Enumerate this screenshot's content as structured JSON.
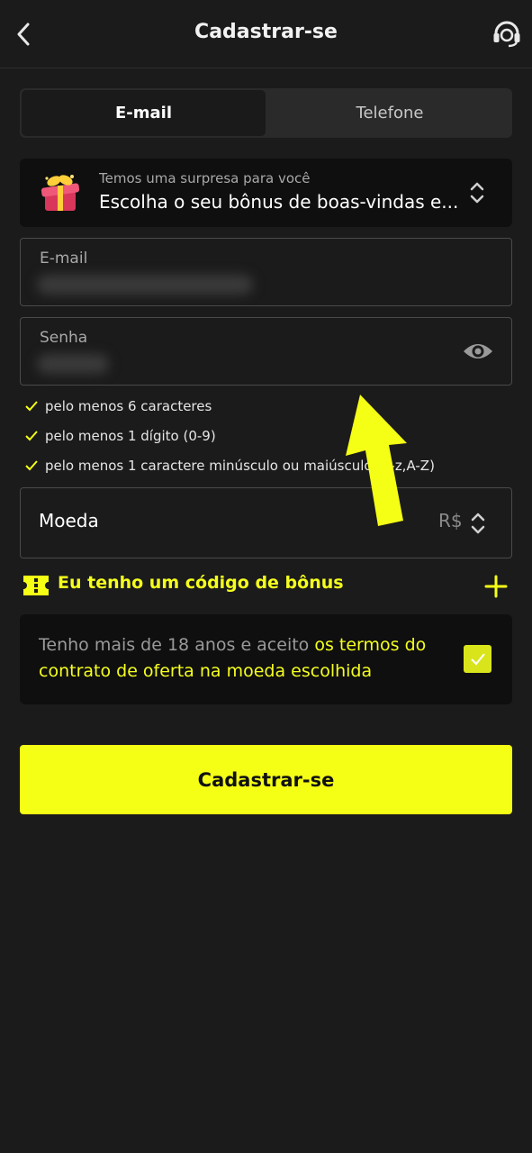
{
  "header": {
    "title": "Cadastrar-se",
    "back_icon": "chevron-left-icon",
    "support_icon": "headset-icon"
  },
  "tabs": [
    {
      "label": "E-mail",
      "active": true
    },
    {
      "label": "Telefone",
      "active": false
    }
  ],
  "bonus_select": {
    "subtitle": "Temos uma surpresa para você",
    "value": "Escolha o seu bônus de boas-vindas e...",
    "icon": "gift-icon"
  },
  "email_field": {
    "label": "E-mail"
  },
  "password_field": {
    "label": "Senha",
    "icon": "eye-icon"
  },
  "password_rules": [
    "pelo menos 6 caracteres",
    "pelo menos 1 dígito (0-9)",
    "pelo menos 1 caractere minúsculo ou maiúsculo (a-z,A-Z)"
  ],
  "currency": {
    "label": "Moeda",
    "value": "R$"
  },
  "bonus_code": {
    "label": "Eu tenho um código de bônus",
    "icon": "ticket-icon"
  },
  "terms": {
    "text": "Tenho mais de 18 anos e aceito ",
    "link": "os termos do contrato de oferta na moeda escolhida",
    "checked": true
  },
  "submit": {
    "label": "Cadastrar-se"
  },
  "colors": {
    "accent": "#f5ff16",
    "background": "#1b1b1b",
    "panel": "#0f0f0f"
  }
}
